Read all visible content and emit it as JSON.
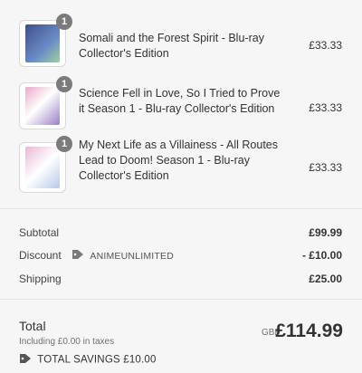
{
  "items": [
    {
      "quantity": "1",
      "title": "Somali and the Forest Spirit - Blu-ray Collector's Edition",
      "price": "£33.33",
      "art_colors": [
        "#3d4f8a",
        "#6a8cc7"
      ]
    },
    {
      "quantity": "1",
      "title": "Science Fell in Love, So I Tried to Prove it Season 1 - Blu-ray Collector's Edition",
      "price": "£33.33",
      "art_colors": [
        "#e8a9c8",
        "#9a7fc4"
      ]
    },
    {
      "quantity": "1",
      "title": "My Next Life as a Villainess - All Routes Lead to Doom! Season 1 - Blu-ray Collector's Edition",
      "price": "£33.33",
      "art_colors": [
        "#e7b9d4",
        "#b7c9ea"
      ]
    }
  ],
  "summary": {
    "subtotal_label": "Subtotal",
    "subtotal_value": "£99.99",
    "discount_label": "Discount",
    "discount_code": "ANIMEUNLIMITED",
    "discount_value": "- £10.00",
    "shipping_label": "Shipping",
    "shipping_value": "£25.00"
  },
  "total": {
    "label": "Total",
    "taxes_note": "Including £0.00 in taxes",
    "currency": "GBP",
    "value": "£114.99",
    "savings": "TOTAL SAVINGS £10.00"
  },
  "icons": {
    "badge": "quantity-badge",
    "discount": "tag-icon",
    "savings": "tag-icon"
  }
}
